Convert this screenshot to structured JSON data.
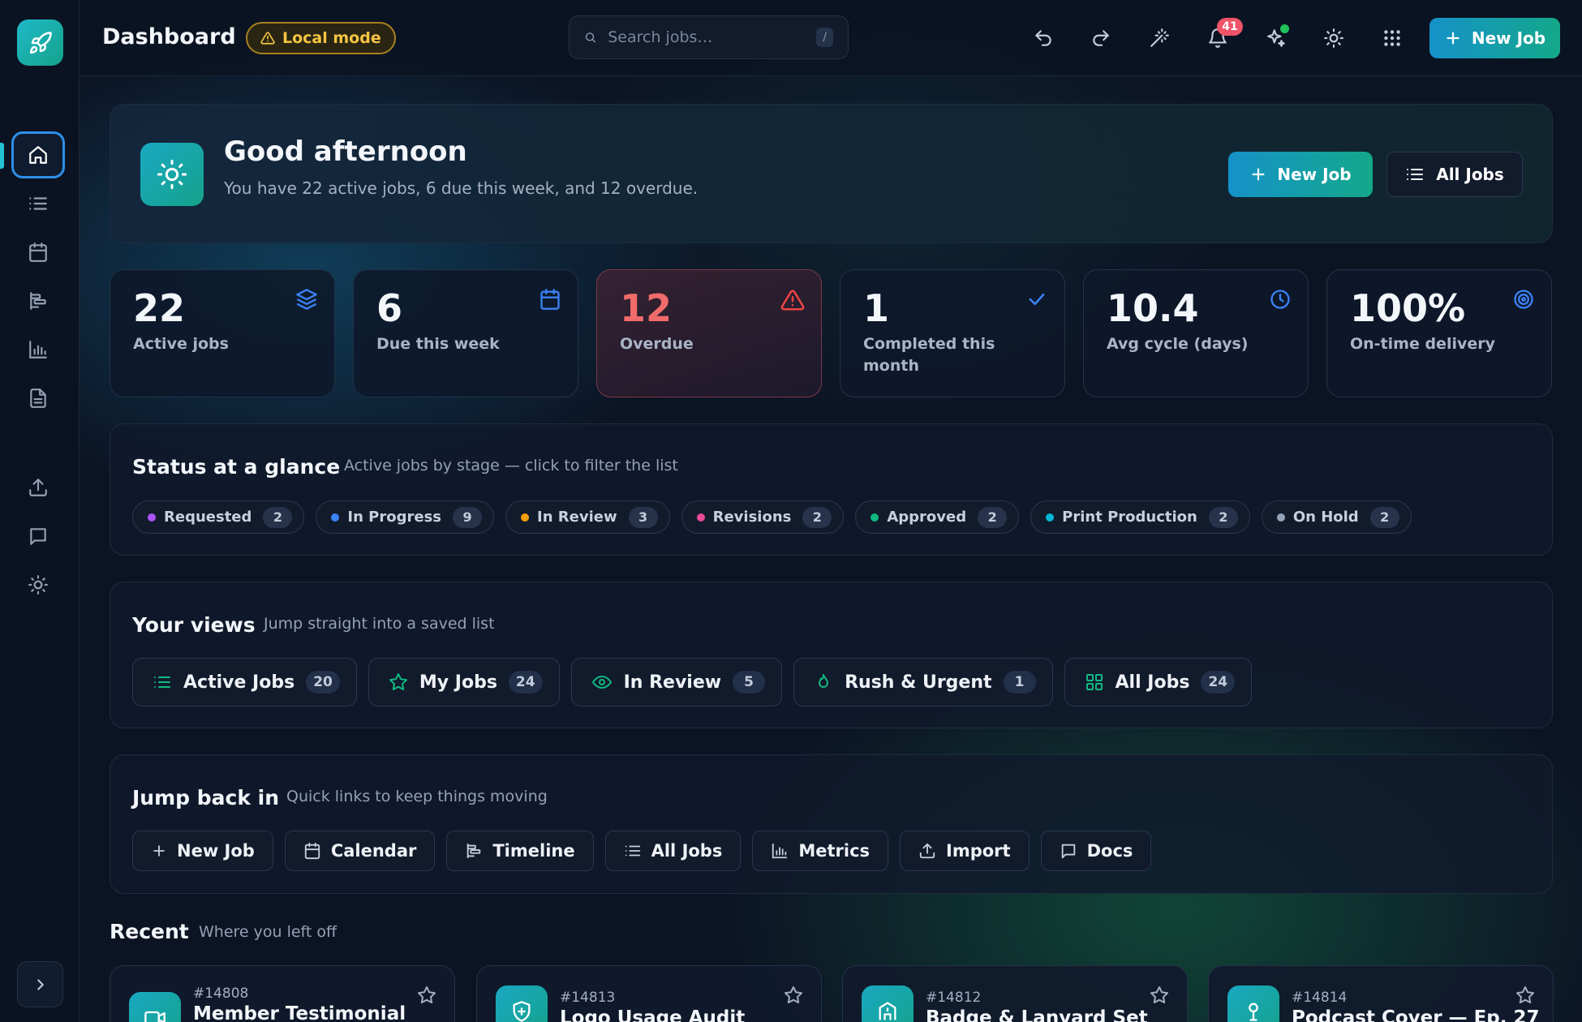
{
  "topbar": {
    "title": "Dashboard",
    "mode_badge": "Local mode",
    "search_placeholder": "Search jobs…",
    "search_shortcut": "/",
    "notification_count": "41",
    "new_job_label": "New Job"
  },
  "hero": {
    "greeting": "Good afternoon",
    "summary": "You have 22 active jobs, 6 due this week, and 12 overdue.",
    "new_job_label": "New Job",
    "all_jobs_label": "All Jobs"
  },
  "stats": [
    {
      "value": "22",
      "label": "Active jobs",
      "icon": "layers-icon",
      "color": "#3b82f6"
    },
    {
      "value": "6",
      "label": "Due this week",
      "icon": "calendar-icon",
      "color": "#3b82f6"
    },
    {
      "value": "12",
      "label": "Overdue",
      "icon": "alert-triangle-icon",
      "color": "#ef4444"
    },
    {
      "value": "1",
      "label": "Completed this month",
      "icon": "check-icon",
      "color": "#3b82f6"
    },
    {
      "value": "10.4",
      "label": "Avg cycle (days)",
      "icon": "clock-icon",
      "color": "#3b82f6"
    },
    {
      "value": "100%",
      "label": "On-time delivery",
      "icon": "target-icon",
      "color": "#3b82f6"
    }
  ],
  "status": {
    "title": "Status at a glance",
    "subtitle": "Active jobs by stage — click to filter the list",
    "chips": [
      {
        "label": "Requested",
        "count": "2",
        "color": "#a855f7"
      },
      {
        "label": "In Progress",
        "count": "9",
        "color": "#3b82f6"
      },
      {
        "label": "In Review",
        "count": "3",
        "color": "#f59e0b"
      },
      {
        "label": "Revisions",
        "count": "2",
        "color": "#ec4899"
      },
      {
        "label": "Approved",
        "count": "2",
        "color": "#10b981"
      },
      {
        "label": "Print Production",
        "count": "2",
        "color": "#06b6d4"
      },
      {
        "label": "On Hold",
        "count": "2",
        "color": "#94a3b8"
      }
    ]
  },
  "views": {
    "title": "Your views",
    "subtitle": "Jump straight into a saved list",
    "items": [
      {
        "label": "Active Jobs",
        "count": "20",
        "icon": "list-icon"
      },
      {
        "label": "My Jobs",
        "count": "24",
        "icon": "star-icon"
      },
      {
        "label": "In Review",
        "count": "5",
        "icon": "eye-icon"
      },
      {
        "label": "Rush & Urgent",
        "count": "1",
        "icon": "flame-icon"
      },
      {
        "label": "All Jobs",
        "count": "24",
        "icon": "grid-icon"
      }
    ]
  },
  "jump": {
    "title": "Jump back in",
    "subtitle": "Quick links to keep things moving",
    "items": [
      {
        "label": "New Job",
        "icon": "plus-icon"
      },
      {
        "label": "Calendar",
        "icon": "calendar-icon"
      },
      {
        "label": "Timeline",
        "icon": "timeline-icon"
      },
      {
        "label": "All Jobs",
        "icon": "list-icon"
      },
      {
        "label": "Metrics",
        "icon": "bar-chart-icon"
      },
      {
        "label": "Import",
        "icon": "upload-icon"
      },
      {
        "label": "Docs",
        "icon": "message-icon"
      }
    ]
  },
  "recent": {
    "title": "Recent",
    "subtitle": "Where you left off",
    "items": [
      {
        "id": "#14808",
        "name": "Member Testimonial",
        "icon": "video-icon"
      },
      {
        "id": "#14813",
        "name": "Logo Usage Audit",
        "icon": "shield-icon"
      },
      {
        "id": "#14812",
        "name": "Badge & Lanyard Set",
        "icon": "building-icon"
      },
      {
        "id": "#14814",
        "name": "Podcast Cover — Ep. 27",
        "icon": "mic-icon"
      }
    ]
  },
  "colors": {
    "accent": "#1592c9",
    "accent2": "#14a88a",
    "warning": "#f5c542",
    "danger": "#f26b6b"
  }
}
